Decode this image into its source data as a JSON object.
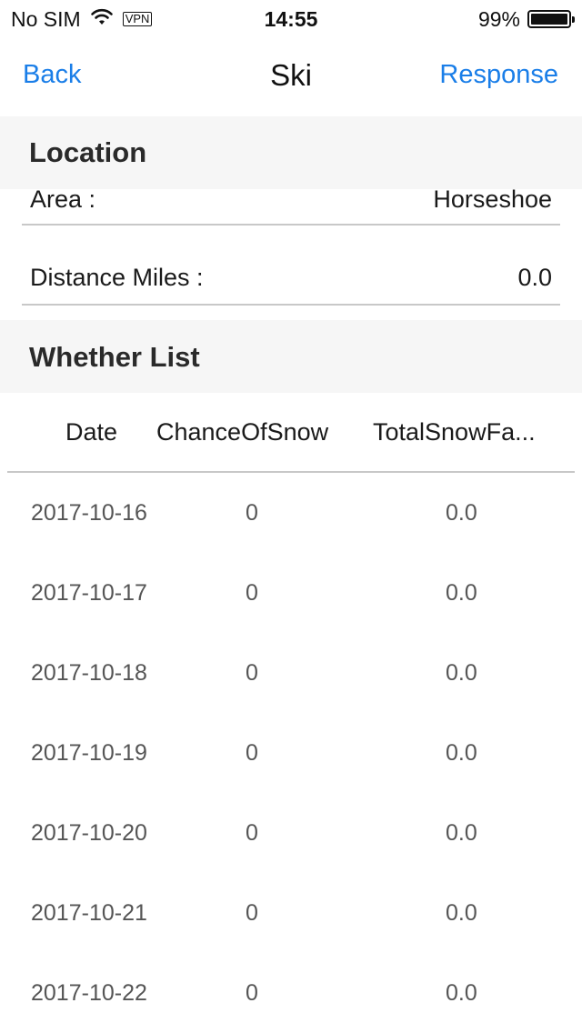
{
  "status_bar": {
    "carrier": "No SIM",
    "vpn": "VPN",
    "time": "14:55",
    "battery_percent": "99%",
    "battery_level": 0.99
  },
  "nav": {
    "back_label": "Back",
    "title": "Ski",
    "right_label": "Response",
    "accent_color": "#1a7ee8"
  },
  "location": {
    "header": "Location",
    "area_label": "Area :",
    "area_value": "Horseshoe",
    "distance_label": "Distance Miles :",
    "distance_value": "0.0"
  },
  "weather": {
    "header": "Whether List",
    "columns": [
      "Date",
      "ChanceOfSnow",
      "TotalSnowFa..."
    ],
    "rows": [
      {
        "date": "2017-10-16",
        "chance": "0",
        "total": "0.0"
      },
      {
        "date": "2017-10-17",
        "chance": "0",
        "total": "0.0"
      },
      {
        "date": "2017-10-18",
        "chance": "0",
        "total": "0.0"
      },
      {
        "date": "2017-10-19",
        "chance": "0",
        "total": "0.0"
      },
      {
        "date": "2017-10-20",
        "chance": "0",
        "total": "0.0"
      },
      {
        "date": "2017-10-21",
        "chance": "0",
        "total": "0.0"
      },
      {
        "date": "2017-10-22",
        "chance": "0",
        "total": "0.0"
      }
    ]
  }
}
